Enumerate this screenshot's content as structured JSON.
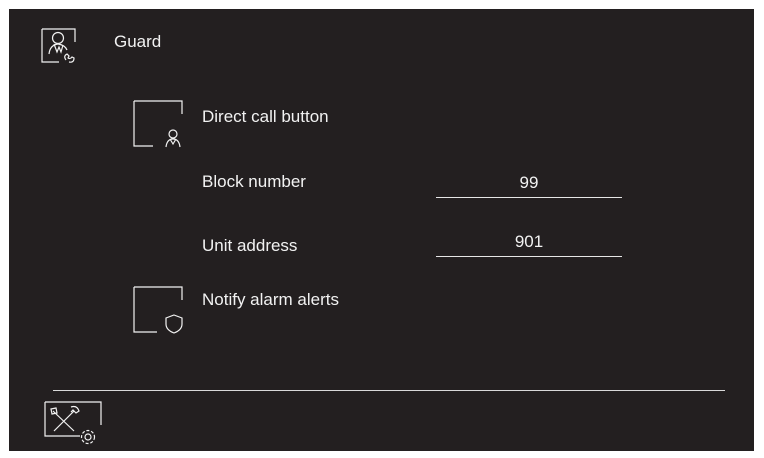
{
  "header": {
    "title": "Guard",
    "icon": "guard-phone-icon"
  },
  "settings": {
    "direct_call": {
      "label": "Direct call button",
      "icon": "guard-person-icon"
    },
    "block_number": {
      "label": "Block number",
      "value": "99"
    },
    "unit_address": {
      "label": "Unit address",
      "value": "901"
    },
    "notify_alarm": {
      "label": "Notify alarm alerts",
      "icon": "shield-icon"
    }
  },
  "footer": {
    "icon": "tools-settings-icon"
  },
  "colors": {
    "background": "#231f20",
    "foreground": "#f2f2f2"
  }
}
